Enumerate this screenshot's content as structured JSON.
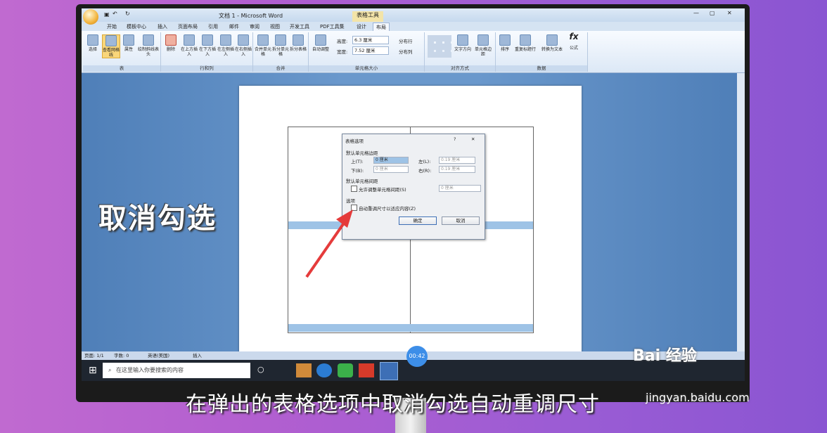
{
  "word": {
    "title": "文档 1 - Microsoft Word",
    "table_tools": "表格工具",
    "tabs": [
      "开始",
      "模板中心",
      "插入",
      "页面布局",
      "引用",
      "邮件",
      "审阅",
      "视图",
      "开发工具",
      "PDF工具集",
      "设计",
      "布局"
    ],
    "ribbon": {
      "groups": {
        "table": "表",
        "rows_cols": "行和列",
        "merge": "合并",
        "cell_size": "单元格大小",
        "align": "对齐方式",
        "data": "数据"
      },
      "buttons": {
        "select": "选择",
        "gridlines": "查看网格线",
        "props": "属性",
        "draw": "绘制斜线表头",
        "delete": "删除",
        "ins_above": "在上方插入",
        "ins_below": "在下方插入",
        "ins_left": "在左侧插入",
        "ins_right": "在右侧插入",
        "merge": "合并单元格",
        "split": "拆分单元格",
        "split_table": "拆分表格",
        "autofit": "自动调整",
        "height_label": "高度:",
        "height_val": "6.3 厘米",
        "width_label": "宽度:",
        "width_val": "7.52 厘米",
        "dist_rows": "分布行",
        "dist_cols": "分布列",
        "text_dir": "文字方向",
        "margins": "单元格边距",
        "sort": "排序",
        "repeat": "重复标题行",
        "convert": "转换为文本",
        "formula": "公式"
      }
    },
    "status": {
      "page": "页面: 1/1",
      "words": "字数: 0",
      "lang": "英语(美国)",
      "mode": "插入",
      "zoom": "100%"
    },
    "timer": "00:42",
    "search_placeholder": "在这里输入你要搜索的内容"
  },
  "dialog": {
    "title": "表格选项",
    "help": "?",
    "close": "✕",
    "section1": "默认单元格边距",
    "top_label": "上(T):",
    "top_val": "0 厘米",
    "left_label": "左(L):",
    "left_val": "0.19 厘米",
    "bottom_label": "下(B):",
    "bottom_val": "0 厘米",
    "right_label": "右(R):",
    "right_val": "0.19 厘米",
    "section2": "默认单元格间距",
    "allow_spacing": "允许调整单元格间距(S)",
    "spacing_val": "0 厘米",
    "section3": "选项",
    "autofit": "自动重调尺寸以适应内容(Z)",
    "ok": "确定",
    "cancel": "取消"
  },
  "captions": {
    "big": "取消勾选",
    "sub": "在弹出的表格选项中取消勾选自动重调尺寸"
  },
  "watermark": {
    "logo": "Bai  经验",
    "url": "jingyan.baidu.com"
  },
  "colors": {
    "accent": "#f9d67a",
    "arrow": "#e53b3b",
    "table_band": "#9ec3e6"
  }
}
